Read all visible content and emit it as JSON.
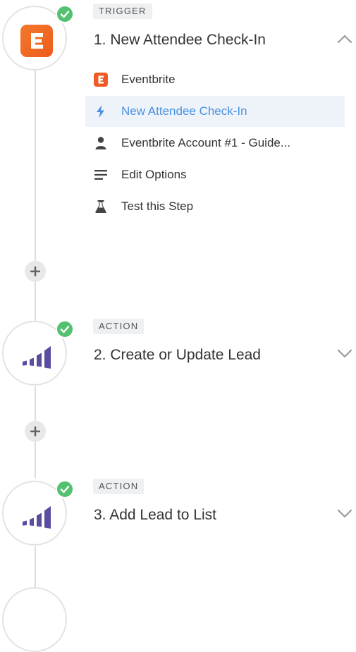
{
  "steps": [
    {
      "badge": "TRIGGER",
      "title": "1. New Attendee Check-In",
      "app": "Eventbrite",
      "expanded": true,
      "subitems": [
        {
          "icon": "eventbrite-icon",
          "label": "Eventbrite"
        },
        {
          "icon": "lightning-icon",
          "label": "New Attendee Check-In",
          "active": true
        },
        {
          "icon": "person-icon",
          "label": "Eventbrite Account #1 - Guide..."
        },
        {
          "icon": "list-icon",
          "label": "Edit Options"
        },
        {
          "icon": "flask-icon",
          "label": "Test this Step"
        }
      ]
    },
    {
      "badge": "ACTION",
      "title": "2. Create or Update Lead",
      "app": "Marketo",
      "expanded": false
    },
    {
      "badge": "ACTION",
      "title": "3. Add Lead to List",
      "app": "Marketo",
      "expanded": false
    }
  ],
  "colors": {
    "check": "#52c271",
    "eventbrite": "#f05a24",
    "marketo": "#5c4c9f",
    "active_text": "#4a90e2",
    "active_bg": "#eef3f9"
  }
}
